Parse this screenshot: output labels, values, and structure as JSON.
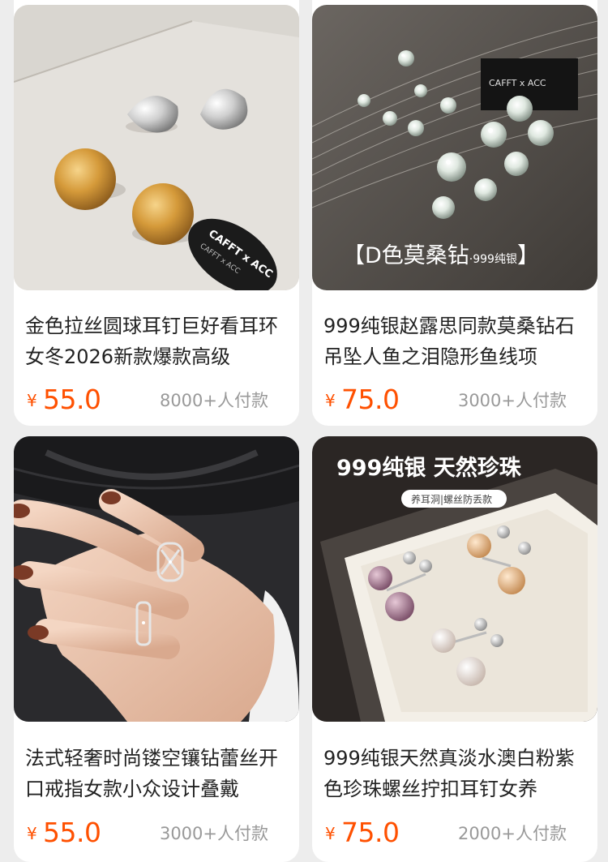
{
  "products": [
    {
      "title": "金色拉丝圆球耳钉巨好看耳环女冬2026新款爆款高级",
      "currency": "¥",
      "price": "55.0",
      "sales": "8000+人付款",
      "image_brand_text": "CAFFT x ACC",
      "image_brand_text_secondary": "CAFFT x ACC"
    },
    {
      "title": "999纯银赵露思同款莫桑钻石吊坠人鱼之泪隐形鱼线项",
      "currency": "¥",
      "price": "75.0",
      "sales": "3000+人付款",
      "image_brand_text": "CAFFT x ACC",
      "image_overlay_text": "【D色莫桑钻",
      "image_overlay_small": "·999纯银",
      "image_overlay_close": "】"
    },
    {
      "title": "法式轻奢时尚镂空镶钻蕾丝开口戒指女款小众设计叠戴",
      "currency": "¥",
      "price": "55.0",
      "sales": "3000+人付款"
    },
    {
      "title": "999纯银天然真淡水澳白粉紫色珍珠螺丝拧扣耳钉女养",
      "currency": "¥",
      "price": "75.0",
      "sales": "2000+人付款",
      "image_banner_text": "999纯银 天然珍珠",
      "image_banner_sub": "养耳洞|螺丝防丢款"
    }
  ],
  "colors": {
    "price": "#ff5000",
    "sales": "#999999",
    "title": "#222222",
    "background": "#ededed"
  }
}
